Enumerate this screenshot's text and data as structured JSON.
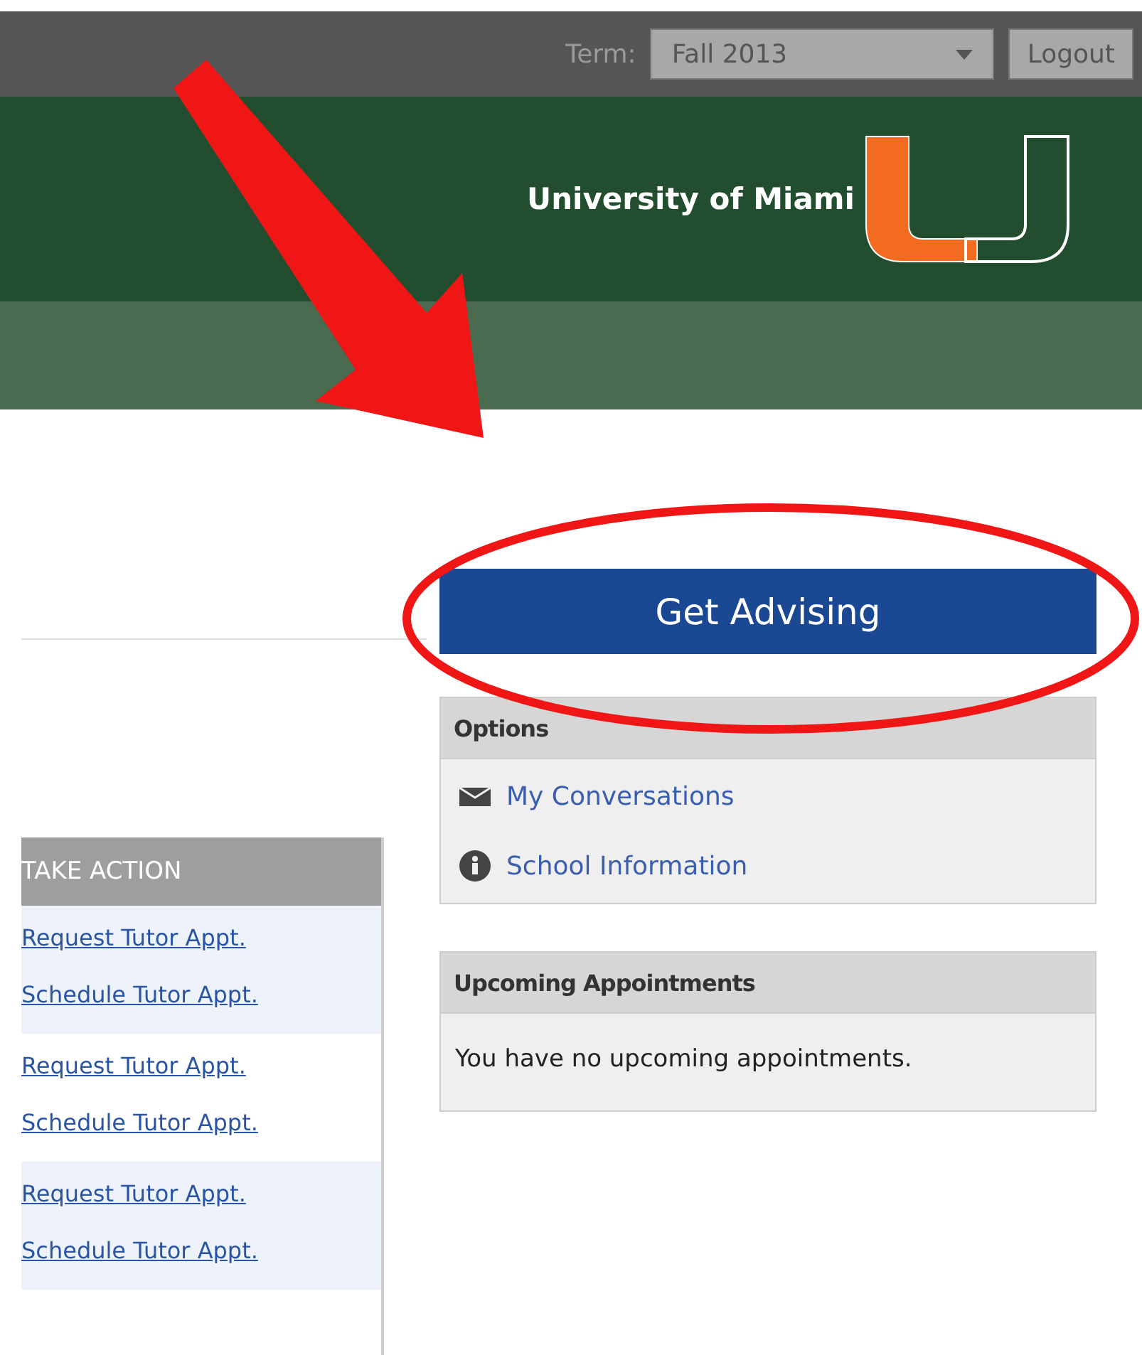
{
  "top_bar": {
    "term_label": "Term:",
    "term_value": "Fall 2013",
    "logout": "Logout"
  },
  "header": {
    "title": "University of Miami"
  },
  "get_advising": "Get Advising",
  "options": {
    "title": "Options",
    "items": [
      {
        "kind": "mail",
        "label": "My Conversations"
      },
      {
        "kind": "info",
        "label": "School Information"
      }
    ]
  },
  "upcoming": {
    "title": "Upcoming Appointments",
    "message": "You have no upcoming appointments."
  },
  "table": {
    "column_header": "TAKE ACTION",
    "rows": [
      {
        "links": [
          "Request Tutor Appt.",
          "Schedule Tutor Appt."
        ]
      },
      {
        "links": [
          "Request Tutor Appt.",
          "Schedule Tutor Appt."
        ]
      },
      {
        "links": [
          "Request Tutor Appt.",
          "Schedule Tutor Appt."
        ]
      }
    ]
  }
}
